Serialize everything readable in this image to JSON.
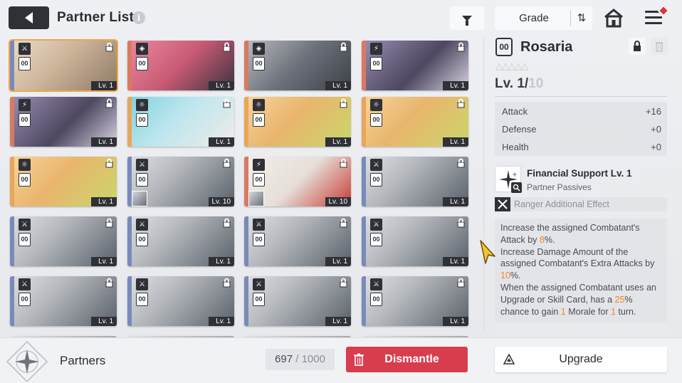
{
  "header": {
    "title": "Partner List",
    "info_icon": "i",
    "filter_icon": "filter-icon",
    "sort": {
      "label": "Grade",
      "icon": "sort-toggle-icon"
    },
    "home_icon": "home-icon",
    "menu_icon": "menu-icon"
  },
  "grid": {
    "cards": [
      {
        "type": "ranger",
        "rank": "00",
        "level": "Lv. 1",
        "art": "brown-hair-girl",
        "selected": true
      },
      {
        "type": "support",
        "rank": "00",
        "level": "Lv. 1",
        "art": "black-cat-creature"
      },
      {
        "type": "support",
        "rank": "00",
        "level": "Lv. 1",
        "art": "armored-figure"
      },
      {
        "type": "striker",
        "rank": "00",
        "level": "Lv. 1",
        "art": "glasses-girl"
      },
      {
        "type": "striker",
        "rank": "00",
        "level": "Lv. 1",
        "art": "glasses-girl"
      },
      {
        "type": "sun",
        "rank": "00",
        "level": "Lv. 1",
        "art": "teal-hair-girl"
      },
      {
        "type": "sun",
        "rank": "00",
        "level": "Lv. 1",
        "art": "blonde-girl"
      },
      {
        "type": "sun",
        "rank": "00",
        "level": "Lv. 1",
        "art": "blonde-girl"
      },
      {
        "type": "sun",
        "rank": "00",
        "level": "Lv. 1",
        "art": "blonde-girl"
      },
      {
        "type": "ranger",
        "rank": "00",
        "level": "Lv. 10",
        "art": "masked-figure"
      },
      {
        "type": "striker",
        "rank": "00",
        "level": "Lv. 10",
        "art": "white-beast"
      },
      {
        "type": "ranger",
        "rank": "00",
        "level": "Lv. 1",
        "art": "masked-figure"
      },
      {
        "type": "ranger",
        "rank": "00",
        "level": "Lv. 1",
        "art": "masked-figure"
      },
      {
        "type": "ranger",
        "rank": "00",
        "level": "Lv. 1",
        "art": "masked-figure"
      },
      {
        "type": "ranger",
        "rank": "00",
        "level": "Lv. 1",
        "art": "masked-figure"
      },
      {
        "type": "ranger",
        "rank": "00",
        "level": "Lv. 1",
        "art": "masked-figure"
      },
      {
        "type": "ranger",
        "rank": "00",
        "level": "Lv. 1",
        "art": "masked-figure"
      },
      {
        "type": "ranger",
        "rank": "00",
        "level": "Lv. 1",
        "art": "masked-figure"
      },
      {
        "type": "ranger",
        "rank": "00",
        "level": "Lv. 1",
        "art": "masked-figure"
      },
      {
        "type": "ranger",
        "rank": "00",
        "level": "Lv. 1",
        "art": "masked-figure"
      }
    ]
  },
  "detail": {
    "rank": "00",
    "name": "Rosaria",
    "stars": "△△△△△",
    "level_current": "Lv. 1/",
    "level_max": "10",
    "stats": [
      {
        "label": "Attack",
        "value": "+16"
      },
      {
        "label": "Defense",
        "value": "+0"
      },
      {
        "label": "Health",
        "value": "+0"
      }
    ],
    "skill": {
      "name": "Financial Support Lv. 1",
      "type": "Partner Passives"
    },
    "ranger_effect": "Ranger Additional Effect",
    "description": {
      "p1a": "Increase the assigned Combatant's Attack by ",
      "p1v": "8",
      "p1b": "%.",
      "p2a": "Increase Damage Amount of the assigned Combatant's Extra Attacks by ",
      "p2v": "10",
      "p2b": "%.",
      "p3a": "When the assigned Combatant uses an Upgrade or Skill Card, has a ",
      "p3v": "25",
      "p3b": "% chance to gain ",
      "p3v2": "1",
      "p3c": " Morale for ",
      "p3v3": "1",
      "p3d": " turn."
    },
    "accent_color": "#f08a24"
  },
  "footer": {
    "section_label": "Partners",
    "count_current": "697",
    "count_sep": " / ",
    "count_max": "1000",
    "dismantle_label": "Dismantle",
    "upgrade_label": "Upgrade",
    "dismantle_color": "#d83d4e"
  }
}
